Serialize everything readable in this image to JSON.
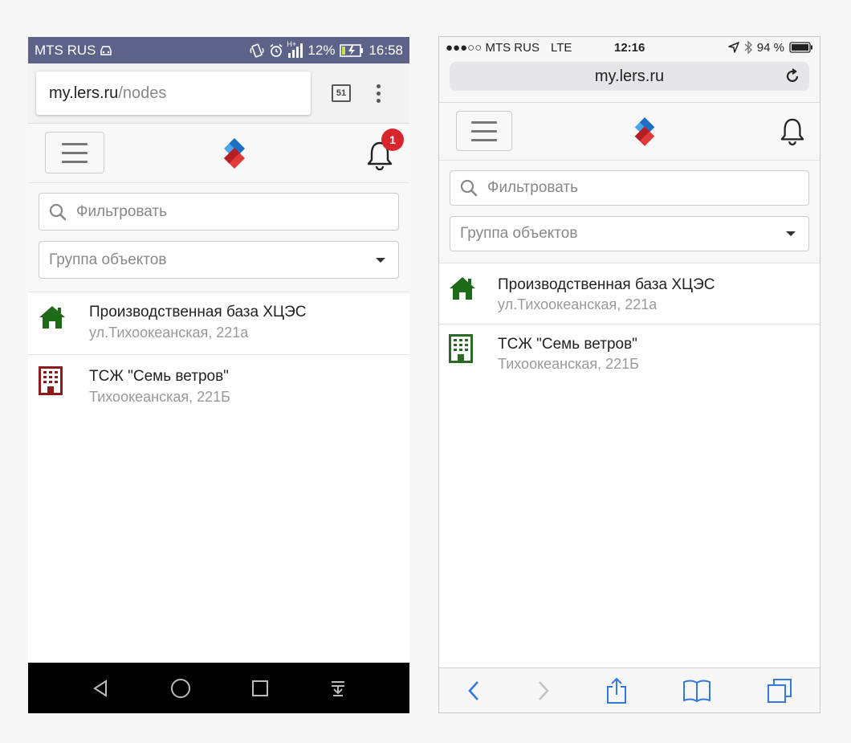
{
  "android": {
    "status": {
      "carrier": "MTS RUS",
      "network": "H+",
      "battery": "12%",
      "time": "16:58"
    },
    "url": {
      "host": "my.lers.ru",
      "path": "/nodes"
    },
    "tabs_count": "51",
    "notifications_count": "1"
  },
  "ios": {
    "status": {
      "carrier": "●●●○○ MTS RUS",
      "network": "LTE",
      "time": "12:16",
      "battery": "94 %"
    },
    "url": "my.lers.ru"
  },
  "app": {
    "filter_placeholder": "Фильтровать",
    "group_placeholder": "Группа объектов",
    "nodes": [
      {
        "title": "Производственная база ХЦЭС",
        "address": "ул.Тихоокеанская, 221а",
        "icon": "house-icon"
      },
      {
        "title": "ТСЖ \"Семь ветров\"",
        "address": "Тихоокеанская, 221Б",
        "icon": "building-icon"
      }
    ]
  },
  "colors": {
    "android_status_bar": "#5d6289",
    "house_green": "#1e6b1a",
    "android_building": "#8e1b1b",
    "ios_building": "#2a6a25",
    "badge_red": "#d9262e",
    "ios_blue": "#3478e6"
  }
}
